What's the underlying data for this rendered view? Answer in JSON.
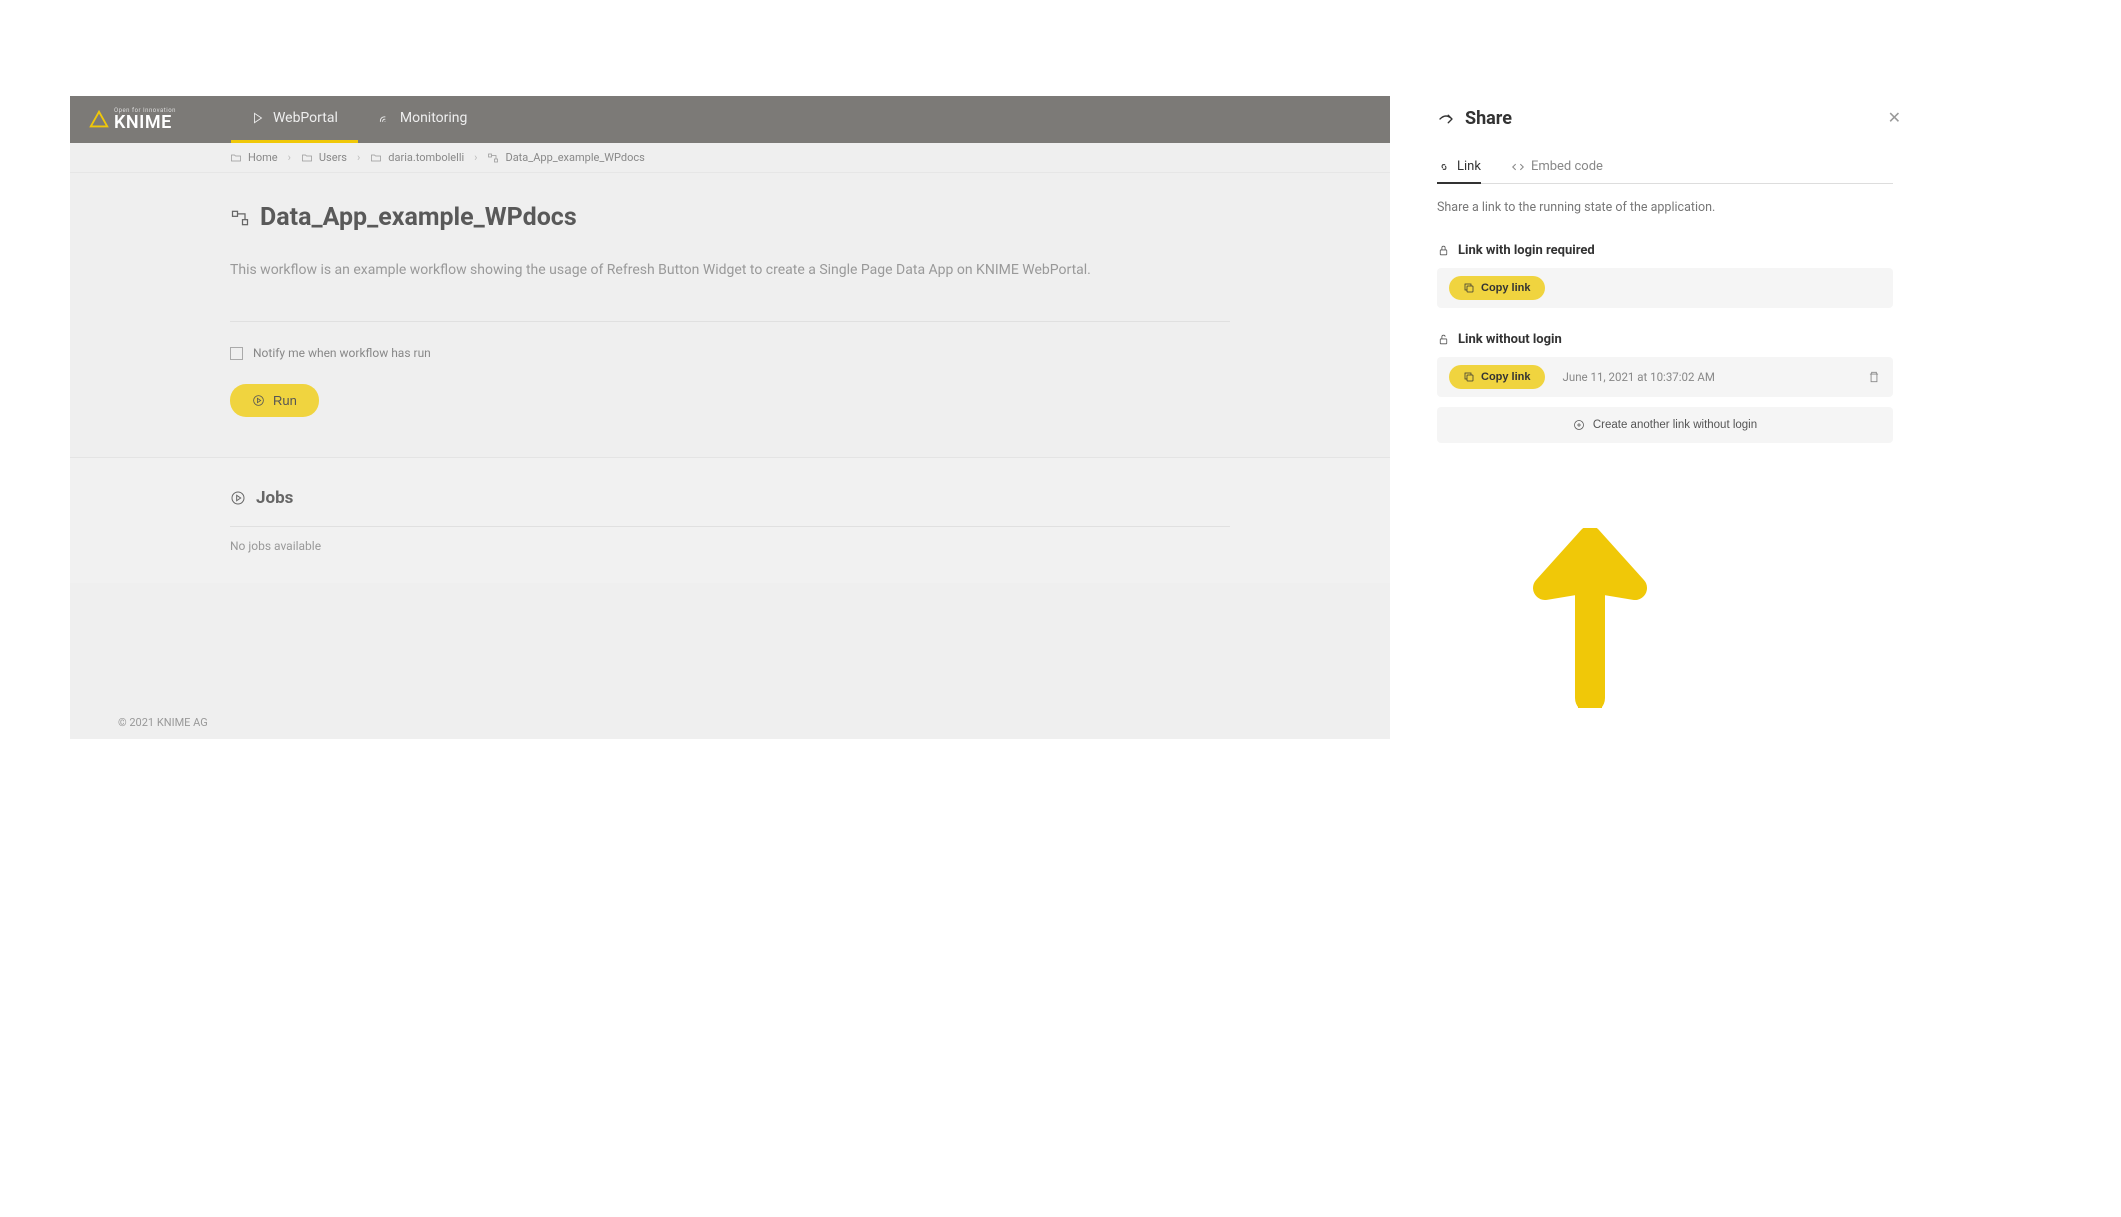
{
  "brand": {
    "tagline": "Open for Innovation",
    "name": "KNIME"
  },
  "nav": {
    "tabs": [
      {
        "label": "WebPortal",
        "active": true
      },
      {
        "label": "Monitoring",
        "active": false
      }
    ]
  },
  "breadcrumb": {
    "items": [
      "Home",
      "Users",
      "daria.tombolelli",
      "Data_App_example_WPdocs"
    ]
  },
  "main": {
    "title": "Data_App_example_WPdocs",
    "description": "This workflow is an example workflow showing the usage of Refresh Button Widget to create a Single Page Data App on KNIME WebPortal.",
    "notify_label": "Notify me when workflow has run",
    "run_label": "Run"
  },
  "jobs": {
    "title": "Jobs",
    "empty": "No jobs available"
  },
  "footer": {
    "copyright": "© 2021 KNIME AG"
  },
  "share": {
    "title": "Share",
    "tabs": [
      {
        "label": "Link",
        "active": true
      },
      {
        "label": "Embed code",
        "active": false
      }
    ],
    "description": "Share a link to the running state of the application.",
    "sections": {
      "login_required": {
        "header": "Link with login required",
        "copy_label": "Copy link"
      },
      "without_login": {
        "header": "Link without login",
        "copy_label": "Copy link",
        "timestamp": "June 11, 2021 at 10:37:02 AM",
        "create_another": "Create another link without login"
      }
    }
  },
  "colors": {
    "accent": "#f0d43f",
    "nav": "#7c7a77"
  }
}
